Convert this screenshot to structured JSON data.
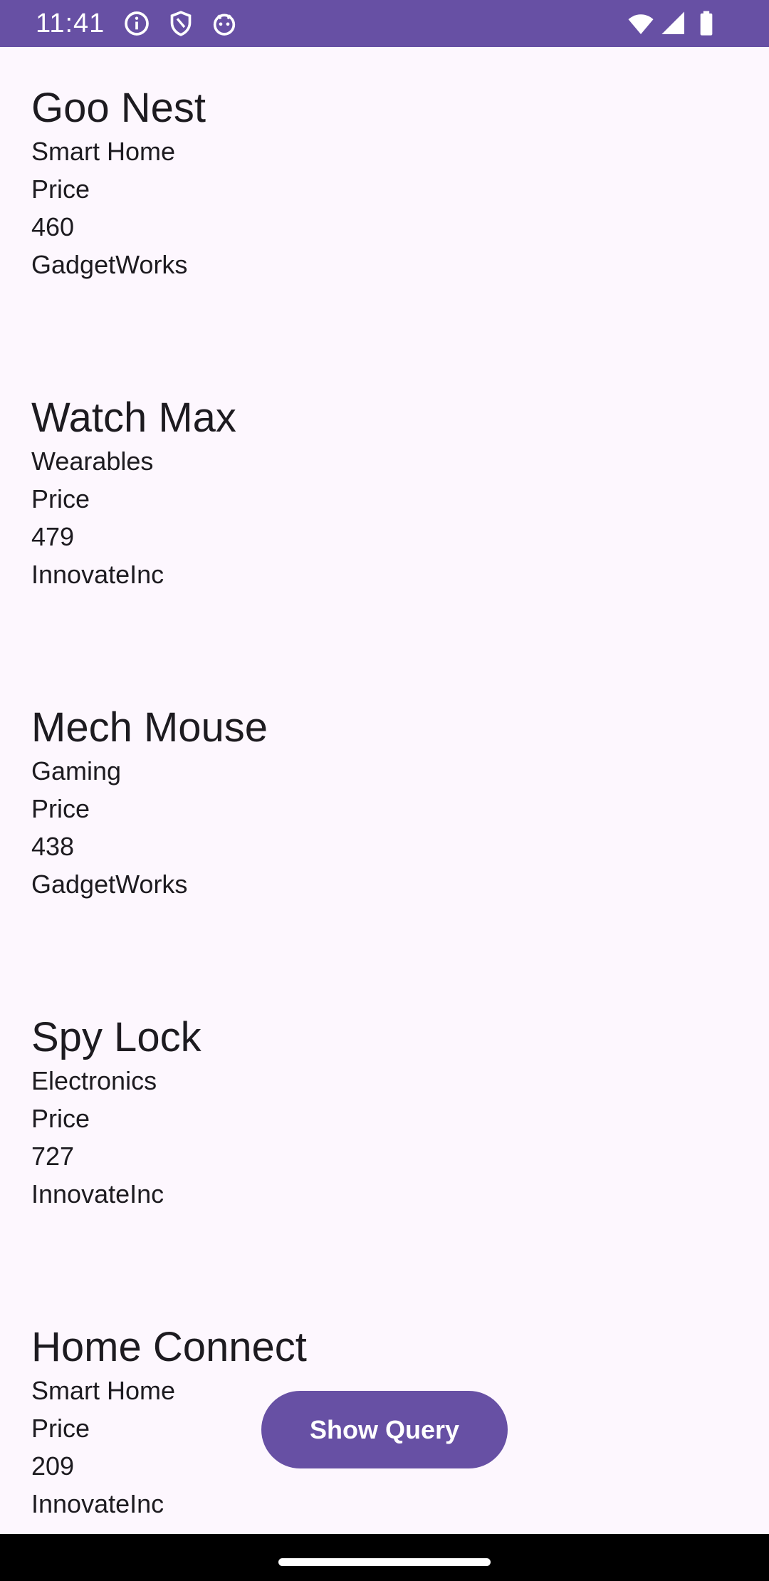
{
  "status_bar": {
    "time": "11:41",
    "left_icons": [
      "info-icon",
      "shield-icon",
      "android-icon"
    ],
    "right_icons": [
      "wifi-icon",
      "signal-icon",
      "battery-icon"
    ],
    "background": "#6750a4"
  },
  "products": [
    {
      "name": "Goo Nest",
      "category": "Smart Home",
      "price_label": "Price",
      "price": "460",
      "manufacturer": "GadgetWorks"
    },
    {
      "name": "Watch Max",
      "category": "Wearables",
      "price_label": "Price",
      "price": "479",
      "manufacturer": "InnovateInc"
    },
    {
      "name": "Mech Mouse",
      "category": "Gaming",
      "price_label": "Price",
      "price": "438",
      "manufacturer": "GadgetWorks"
    },
    {
      "name": "Spy Lock",
      "category": "Electronics",
      "price_label": "Price",
      "price": "727",
      "manufacturer": "InnovateInc"
    },
    {
      "name": "Home Connect",
      "category": "Smart Home",
      "price_label": "Price",
      "price": "209",
      "manufacturer": "InnovateInc"
    }
  ],
  "fab": {
    "label": "Show Query",
    "color": "#6750a4"
  },
  "nav_bar": {
    "handle": "home-gesture-handle"
  }
}
